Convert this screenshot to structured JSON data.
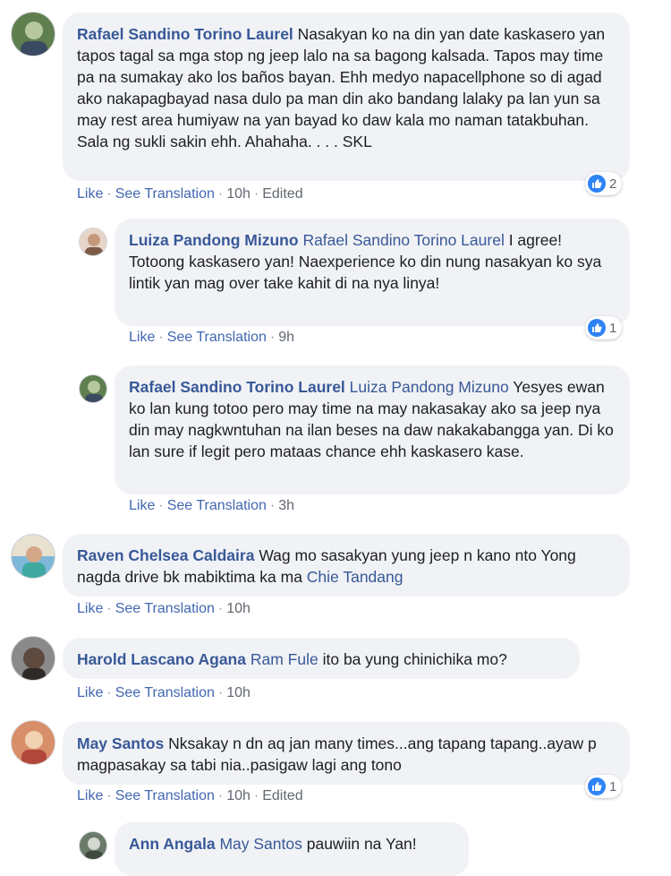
{
  "actions": {
    "like": "Like",
    "see_translation": "See Translation",
    "dot": "·"
  },
  "comments": [
    {
      "author": "Rafael Sandino Torino Laurel",
      "mention": "",
      "text": "Nasakyan ko na din yan date kaskasero yan tapos tagal sa mga stop ng jeep lalo na sa bagong kalsada. Tapos may time pa na sumakay ako los baños bayan. Ehh medyo napacellphone so di agad ako nakapagbayad nasa dulo pa man din ako bandang lalaky pa lan yun sa may rest area humiyaw na yan bayad ko daw kala mo naman tatakbuhan. Sala ng sukli sakin ehh. Ahahaha. . . . SKL",
      "time": "10h",
      "edited": "Edited",
      "reactions": "2",
      "avatar_colors": [
        "#5f7f4f",
        "#b7c8a0",
        "#3b4a63"
      ]
    },
    {
      "author": "Luiza Pandong Mizuno",
      "mention": "Rafael Sandino Torino Laurel",
      "text": "I agree! Totoong kaskasero yan! Naexperience ko din nung nasakyan ko sya lintik yan mag over take kahit di na nya linya!",
      "time": "9h",
      "edited": "",
      "reactions": "1",
      "avatar_colors": [
        "#e6d5c9",
        "#c59a7c",
        "#7d5a47"
      ]
    },
    {
      "author": "Rafael Sandino Torino Laurel",
      "mention": "Luiza Pandong Mizuno",
      "text": "Yesyes ewan ko lan kung totoo pero may time na may nakasakay ako sa jeep nya din may nagkwntuhan na ilan beses na daw nakakabangga yan. Di ko lan sure if legit pero mataas chance ehh kaskasero kase.",
      "time": "3h",
      "edited": "",
      "reactions": "",
      "avatar_colors": [
        "#5f7f4f",
        "#b7c8a0",
        "#3b4a63"
      ]
    },
    {
      "author": "Raven Chelsea Caldaira",
      "mention": "",
      "text": "Wag mo sasakyan yung jeep n kano nto Yong nagda drive bk mabiktima ka ma",
      "mention_after": "Chie Tandang",
      "time": "10h",
      "edited": "",
      "reactions": "",
      "avatar_colors": [
        "#7fb7d9",
        "#e8e1cf",
        "#3fa9a0"
      ]
    },
    {
      "author": "Harold Lascano Agana",
      "mention": "Ram Fule",
      "text": "ito ba yung chinichika mo?",
      "time": "10h",
      "edited": "",
      "reactions": "",
      "avatar_colors": [
        "#8a8a8a",
        "#5e4a3e",
        "#2f2a28"
      ]
    },
    {
      "author": "May Santos",
      "mention": "",
      "text": "Nksakay n dn aq jan many times...ang tapang tapang..ayaw p magpasakay sa tabi nia..pasigaw lagi ang tono",
      "time": "10h",
      "edited": "Edited",
      "reactions": "1",
      "avatar_colors": [
        "#d98e6a",
        "#f1d3b3",
        "#b2473c"
      ]
    },
    {
      "author": "Ann Angala",
      "mention": "May Santos",
      "text": "pauwiin na Yan!",
      "time": "",
      "edited": "",
      "reactions": "",
      "avatar_colors": [
        "#6b7b6a",
        "#d3d7cf",
        "#3f4a3f"
      ]
    }
  ]
}
